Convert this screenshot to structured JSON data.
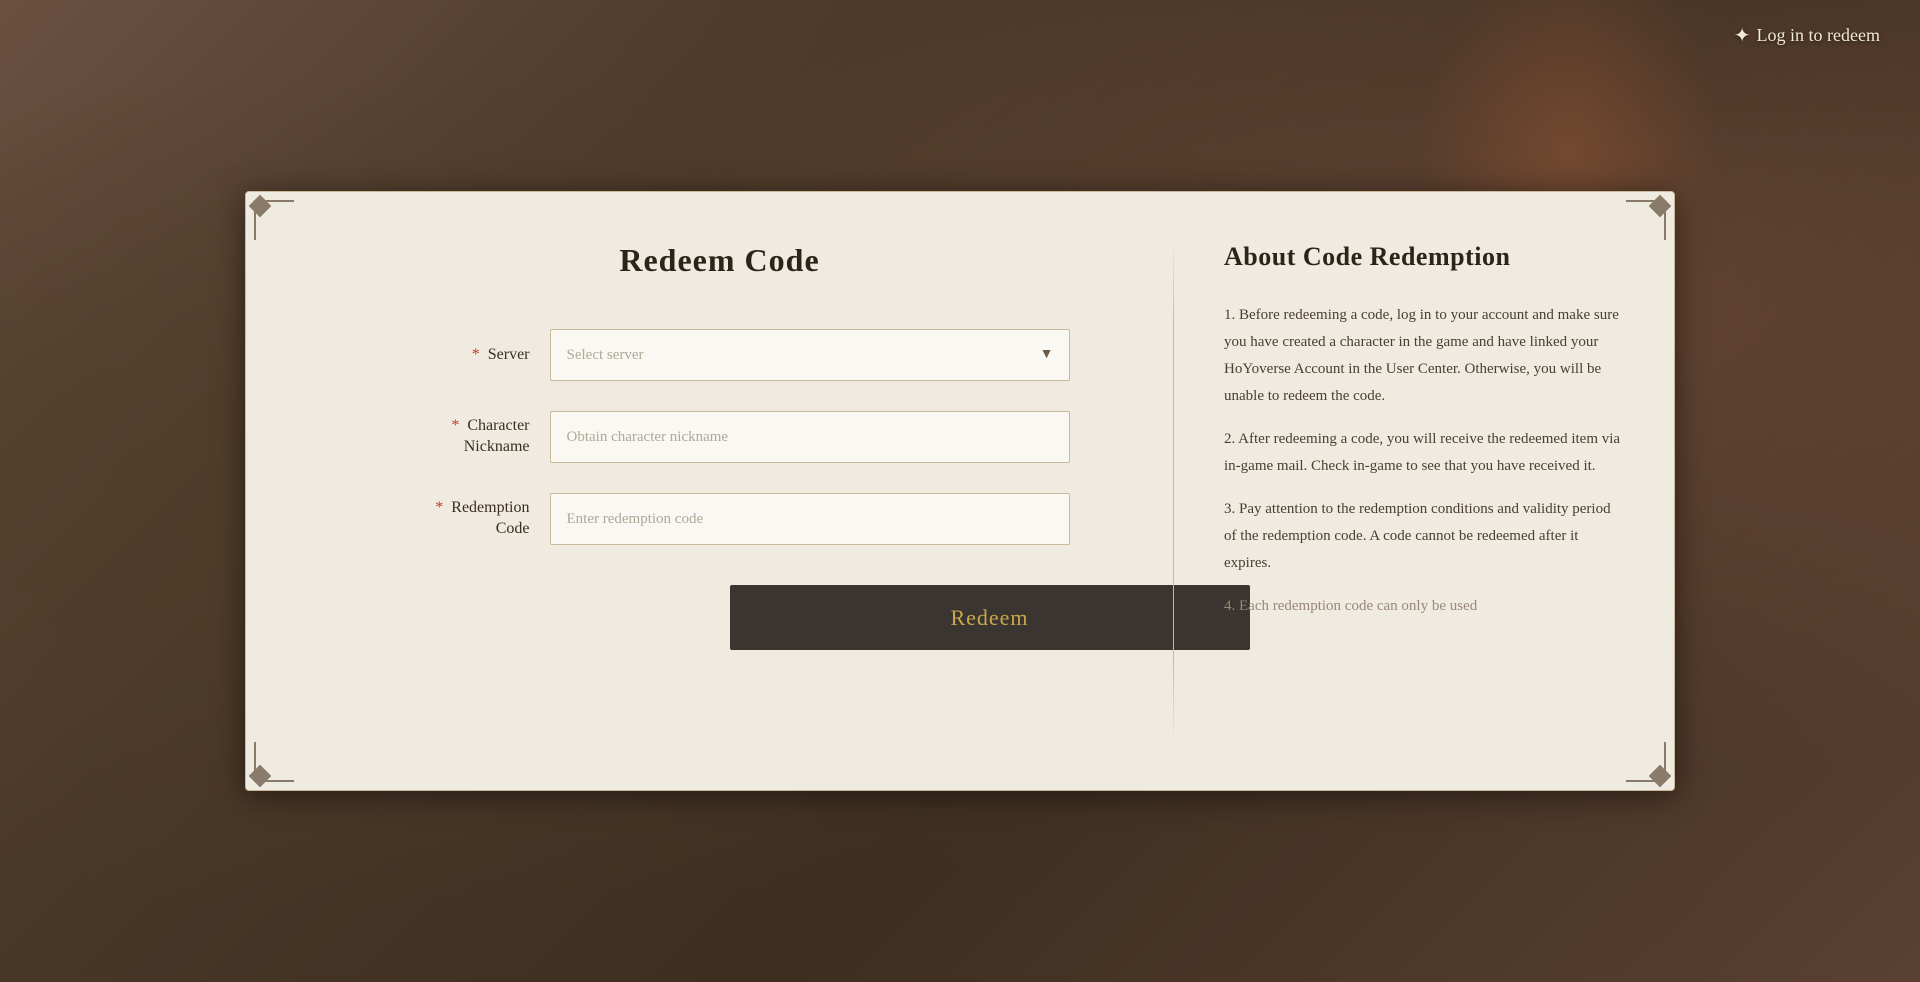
{
  "topbar": {
    "login_label": "Log in to redeem"
  },
  "form": {
    "title": "Redeem Code",
    "fields": {
      "server": {
        "label": "Server",
        "placeholder": "Select server",
        "required": true
      },
      "nickname": {
        "label": "Character\nNickname",
        "label_line1": "Character",
        "label_line2": "Nickname",
        "placeholder": "Obtain character nickname",
        "required": true
      },
      "code": {
        "label": "Redemption\nCode",
        "label_line1": "Redemption",
        "label_line2": "Code",
        "placeholder": "Enter redemption code",
        "required": true
      }
    },
    "submit_label": "Redeem"
  },
  "info": {
    "title": "About Code Redemption",
    "items": [
      {
        "text": "1. Before redeeming a code, log in to your account and make sure you have created a character in the game and have linked your HoYoverse Account in the User Center. Otherwise, you will be unable to redeem the code."
      },
      {
        "text": "2. After redeeming a code, you will receive the redeemed item via in-game mail. Check in-game to see that you have received it."
      },
      {
        "text": "3. Pay attention to the redemption conditions and validity period of the redemption code. A code cannot be redeemed after it expires."
      },
      {
        "text": "4. Each redemption code can only be used",
        "faded": true
      }
    ]
  },
  "colors": {
    "required_star": "#c0392b",
    "accent": "#c9a84c",
    "panel_bg": "#f0ebe0",
    "border": "#c8b99a",
    "text_dark": "#2c2418",
    "button_bg": "#3a3530"
  }
}
